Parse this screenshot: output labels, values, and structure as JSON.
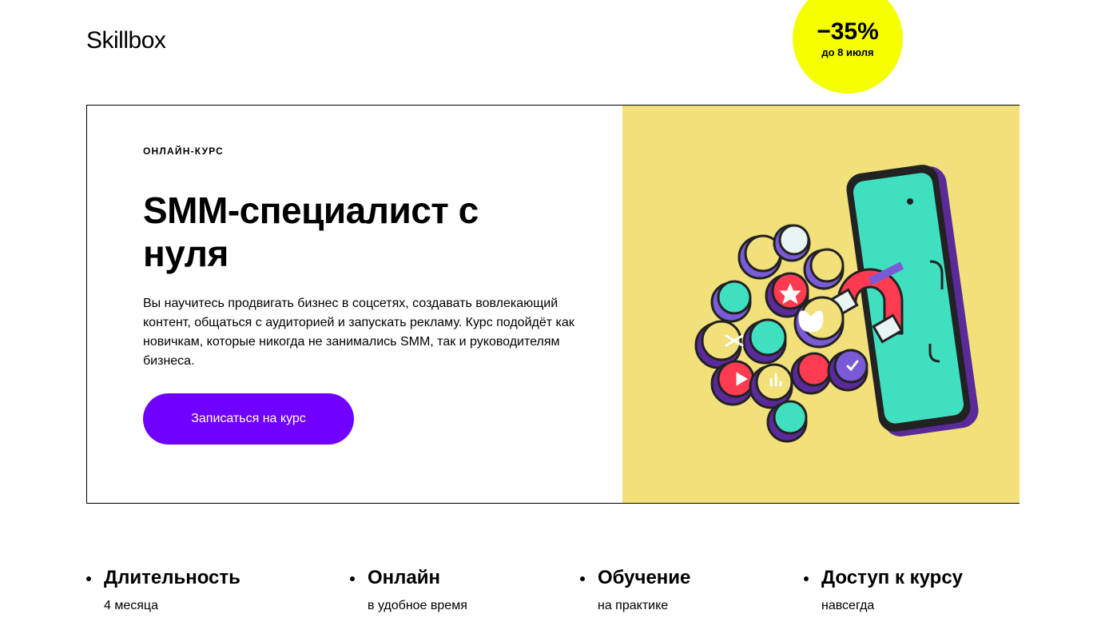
{
  "brand": {
    "logo": "Skillbox"
  },
  "hero": {
    "eyebrow": "ОНЛАЙН-КУРС",
    "title": "SMM-специалист с нуля",
    "description": "Вы научитесь продвигать бизнес в соцсетях, создавать вовлекающий контент, общаться с аудиторией и запускать рекламу. Курс подойдёт как новичкам, которые никогда не занимались SMM, так и руководителям бизнеса.",
    "cta_label": "Записаться на курс",
    "discount": {
      "percent": "−35%",
      "until": "до 8 июля"
    },
    "colors": {
      "accent": "#7000ff",
      "illustration_bg": "#f2e07a",
      "badge": "#f5ff00"
    }
  },
  "features": [
    {
      "title": "Длительность",
      "subtitle": "4 месяца"
    },
    {
      "title": "Онлайн",
      "subtitle": "в удобное время"
    },
    {
      "title": "Обучение",
      "subtitle": "на практике"
    },
    {
      "title": "Доступ к курсу",
      "subtitle": "навсегда"
    }
  ]
}
